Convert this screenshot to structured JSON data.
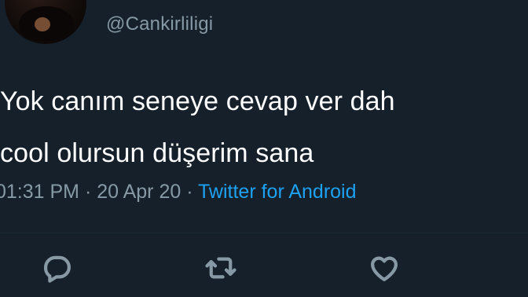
{
  "tweet": {
    "handle": "@Cankirliligi",
    "text_lines": [
      "Yok canım seneye cevap ver dah",
      "cool olursun düşerim sana"
    ],
    "time": "01:31 PM",
    "separator": " · ",
    "date": "20 Apr 20",
    "source": "Twitter for Android"
  },
  "actions": {
    "reply_icon": "reply-icon",
    "retweet_icon": "retweet-icon",
    "like_icon": "heart-icon"
  },
  "colors": {
    "background": "#15202b",
    "text": "#ffffff",
    "muted": "#8899a6",
    "accent": "#1da1f2"
  }
}
